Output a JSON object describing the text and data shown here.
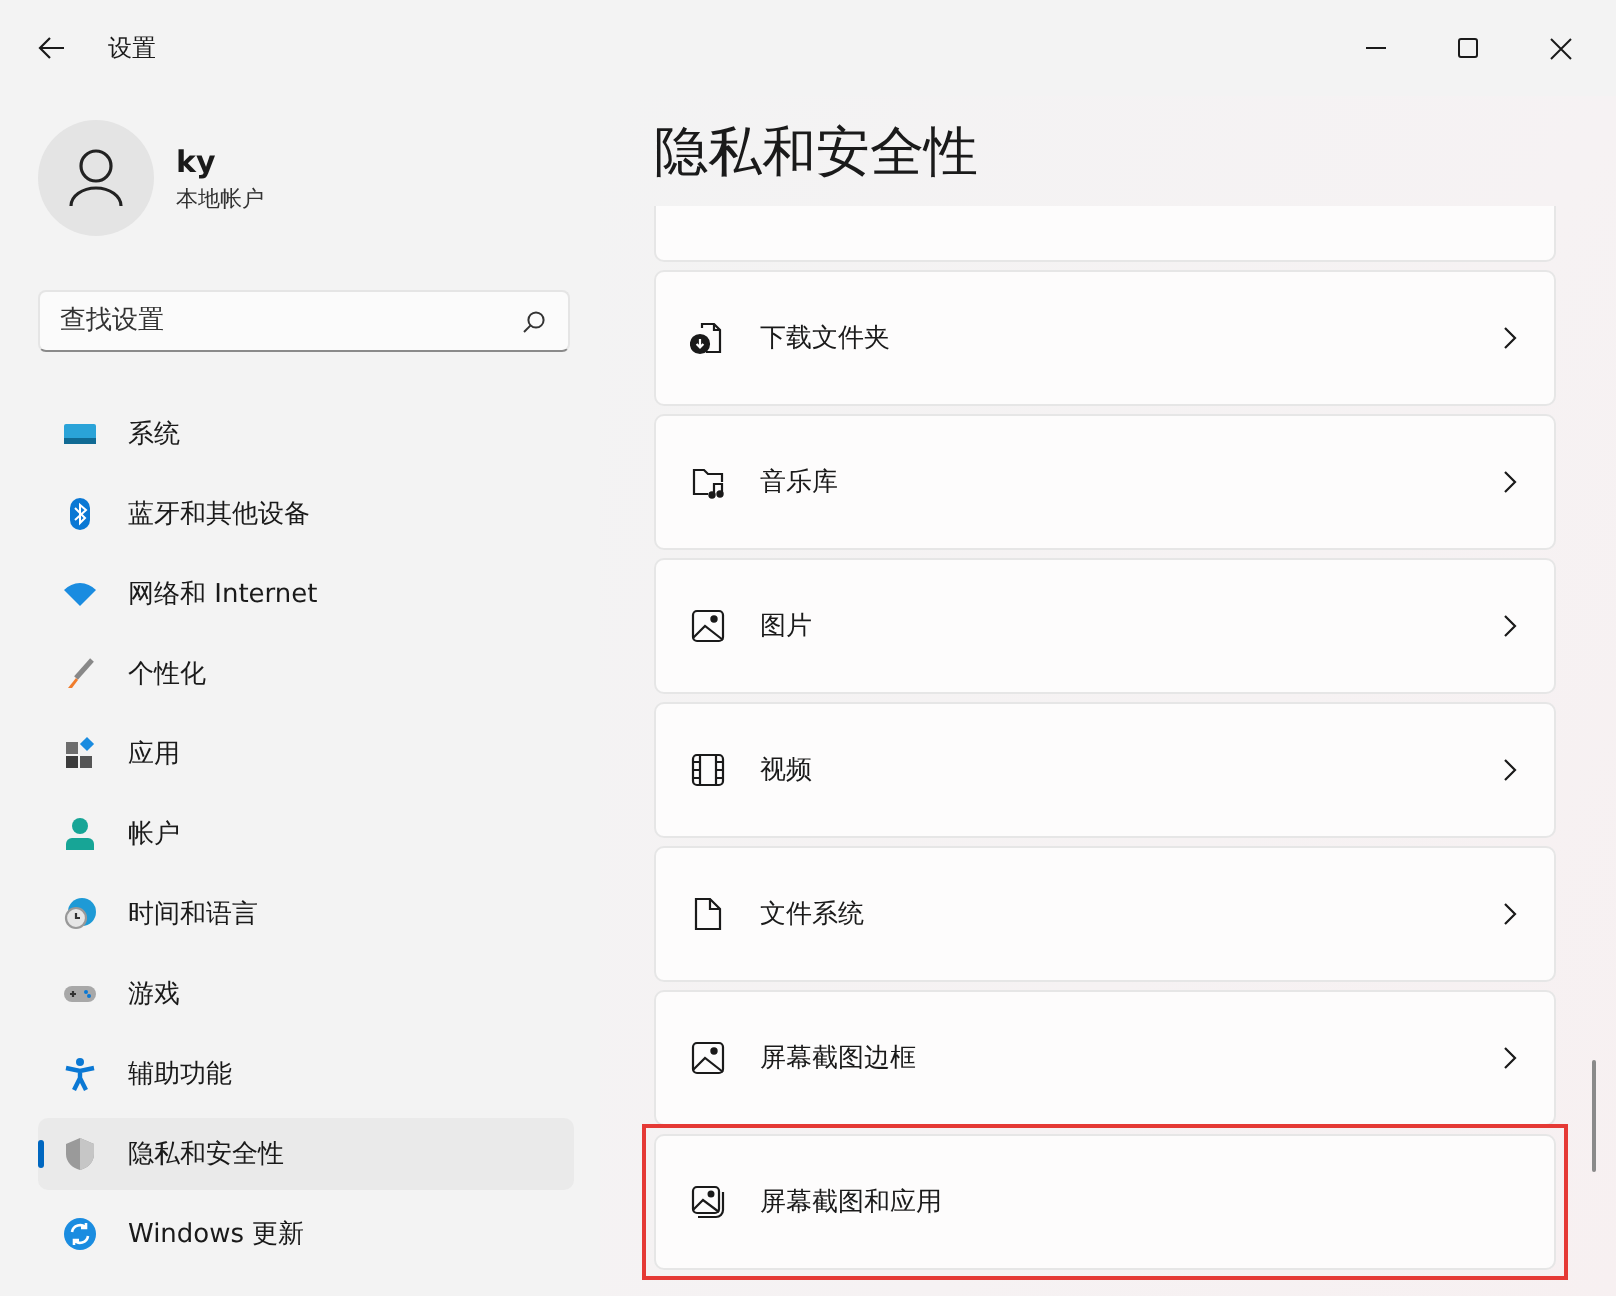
{
  "window": {
    "title": "设置"
  },
  "user": {
    "name": "ky",
    "account": "本地帐户"
  },
  "search": {
    "placeholder": "查找设置"
  },
  "nav": [
    {
      "label": "系统",
      "kind": "system",
      "selected": false
    },
    {
      "label": "蓝牙和其他设备",
      "kind": "bluetooth",
      "selected": false
    },
    {
      "label": "网络和 Internet",
      "kind": "network",
      "selected": false
    },
    {
      "label": "个性化",
      "kind": "brush",
      "selected": false
    },
    {
      "label": "应用",
      "kind": "apps",
      "selected": false
    },
    {
      "label": "帐户",
      "kind": "account",
      "selected": false
    },
    {
      "label": "时间和语言",
      "kind": "time",
      "selected": false
    },
    {
      "label": "游戏",
      "kind": "game",
      "selected": false
    },
    {
      "label": "辅助功能",
      "kind": "access",
      "selected": false
    },
    {
      "label": "隐私和安全性",
      "kind": "shield",
      "selected": true
    },
    {
      "label": "Windows 更新",
      "kind": "update",
      "selected": false
    }
  ],
  "page": {
    "title": "隐私和安全性"
  },
  "cards": [
    {
      "label": "下载文件夹",
      "kind": "download",
      "chevron": true,
      "highlighted": false
    },
    {
      "label": "音乐库",
      "kind": "music",
      "chevron": true,
      "highlighted": false
    },
    {
      "label": "图片",
      "kind": "image",
      "chevron": true,
      "highlighted": false
    },
    {
      "label": "视频",
      "kind": "video",
      "chevron": true,
      "highlighted": false
    },
    {
      "label": "文件系统",
      "kind": "file",
      "chevron": true,
      "highlighted": false
    },
    {
      "label": "屏幕截图边框",
      "kind": "image",
      "chevron": true,
      "highlighted": false
    },
    {
      "label": "屏幕截图和应用",
      "kind": "image-stack",
      "chevron": false,
      "highlighted": true
    }
  ]
}
